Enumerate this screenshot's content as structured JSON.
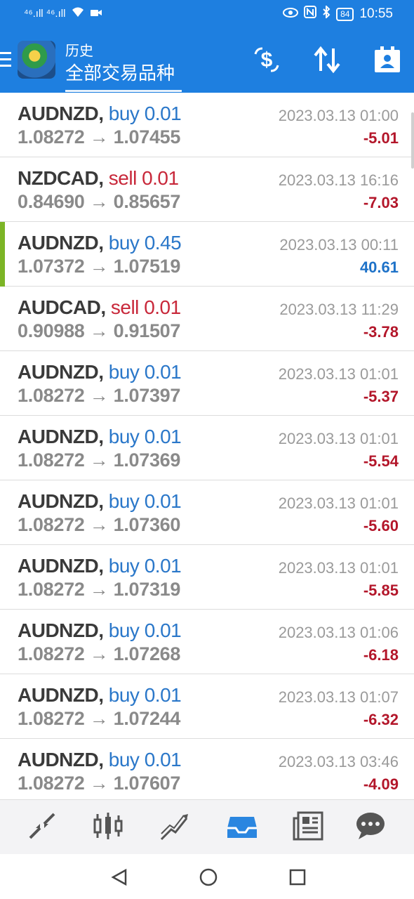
{
  "status_bar": {
    "signals": "⁴⁶.ıll ⁴⁶.ıll",
    "battery": "84",
    "time": "10:55"
  },
  "header": {
    "subtitle": "历史",
    "title": "全部交易品种"
  },
  "trades": [
    {
      "symbol": "AUDNZD,",
      "side": "buy",
      "volume": "0.01",
      "open": "1.08272",
      "close": "1.07455",
      "time": "2023.03.13 01:00",
      "profit": "-5.01"
    },
    {
      "symbol": "NZDCAD,",
      "side": "sell",
      "volume": "0.01",
      "open": "0.84690",
      "close": "0.85657",
      "time": "2023.03.13 16:16",
      "profit": "-7.03"
    },
    {
      "symbol": "AUDNZD,",
      "side": "buy",
      "volume": "0.45",
      "open": "1.07372",
      "close": "1.07519",
      "time": "2023.03.13 00:11",
      "profit": "40.61"
    },
    {
      "symbol": "AUDCAD,",
      "side": "sell",
      "volume": "0.01",
      "open": "0.90988",
      "close": "0.91507",
      "time": "2023.03.13 11:29",
      "profit": "-3.78"
    },
    {
      "symbol": "AUDNZD,",
      "side": "buy",
      "volume": "0.01",
      "open": "1.08272",
      "close": "1.07397",
      "time": "2023.03.13 01:01",
      "profit": "-5.37"
    },
    {
      "symbol": "AUDNZD,",
      "side": "buy",
      "volume": "0.01",
      "open": "1.08272",
      "close": "1.07369",
      "time": "2023.03.13 01:01",
      "profit": "-5.54"
    },
    {
      "symbol": "AUDNZD,",
      "side": "buy",
      "volume": "0.01",
      "open": "1.08272",
      "close": "1.07360",
      "time": "2023.03.13 01:01",
      "profit": "-5.60"
    },
    {
      "symbol": "AUDNZD,",
      "side": "buy",
      "volume": "0.01",
      "open": "1.08272",
      "close": "1.07319",
      "time": "2023.03.13 01:01",
      "profit": "-5.85"
    },
    {
      "symbol": "AUDNZD,",
      "side": "buy",
      "volume": "0.01",
      "open": "1.08272",
      "close": "1.07268",
      "time": "2023.03.13 01:06",
      "profit": "-6.18"
    },
    {
      "symbol": "AUDNZD,",
      "side": "buy",
      "volume": "0.01",
      "open": "1.08272",
      "close": "1.07244",
      "time": "2023.03.13 01:07",
      "profit": "-6.32"
    },
    {
      "symbol": "AUDNZD,",
      "side": "buy",
      "volume": "0.01",
      "open": "1.08272",
      "close": "1.07607",
      "time": "2023.03.13 03:46",
      "profit": "-4.09"
    }
  ],
  "colors": {
    "header_bg": "#1e7fe0",
    "buy": "#2a77c9",
    "sell": "#c8283a",
    "loss": "#b3162a",
    "gain": "#1e72c8",
    "highlight_accent": "#7cb526",
    "active_nav": "#2a86e0"
  },
  "icons": {
    "header": [
      "menu-icon",
      "app-logo",
      "currency-exchange-icon",
      "sort-icon",
      "contact-card-icon"
    ],
    "bottom_nav": [
      "quotes-icon",
      "chart-icon",
      "trade-icon",
      "history-icon",
      "news-icon",
      "chat-icon"
    ],
    "system_nav": [
      "back-icon",
      "home-icon",
      "recents-icon"
    ]
  },
  "active_tab": "history"
}
